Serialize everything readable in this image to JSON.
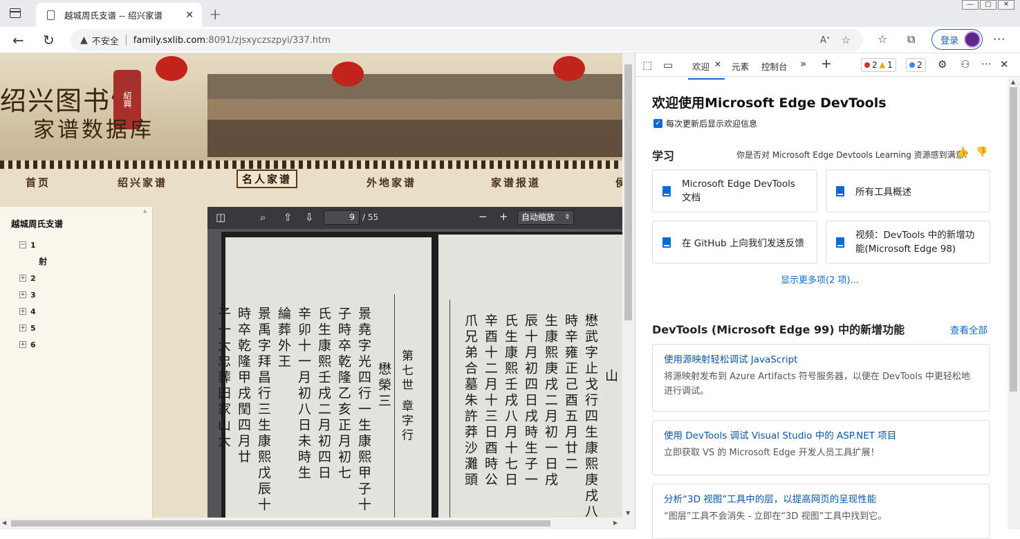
{
  "browser": {
    "tab_title": "越城周氏支谱 -- 绍兴家谱",
    "tab_close": "✕",
    "new_tab": "+",
    "security_label": "不安全",
    "url_host": "family.sxlib.com",
    "url_path": ":8091/zjsxyczszpyi/337.htm",
    "read_aloud": "A̩)",
    "login_label": "登录"
  },
  "site": {
    "banner_title_1": "绍兴图书馆",
    "banner_title_2": "家谱数据库",
    "seal_text": "紹興",
    "menu": [
      "首页",
      "绍兴家谱",
      "名人家谱",
      "外地家谱",
      "家谱报道",
      "侯"
    ],
    "menu_active": 2
  },
  "tree": {
    "root": "越城周氏支谱",
    "nodes": [
      {
        "label": "1",
        "expanded": true,
        "children": [
          "射"
        ]
      },
      {
        "label": "2",
        "expanded": false,
        "children": []
      },
      {
        "label": "3",
        "expanded": false,
        "children": []
      },
      {
        "label": "4",
        "expanded": false,
        "children": []
      },
      {
        "label": "5",
        "expanded": false,
        "children": []
      },
      {
        "label": "6",
        "expanded": false,
        "children": []
      }
    ]
  },
  "viewer": {
    "current_page": "9",
    "total_pages": "/ 55",
    "zoom_label": "自动缩放",
    "scan_columns_right": [
      "山",
      "懋武字止戈行四生康熙庚戌八",
      "時辛雍正己酉五月廿二",
      "生康熙庚戌二月初一日戌",
      "辰十月初四日戌時生子一",
      "氏生康熙壬戌八月十七日",
      "辛酉十二月十三日酉時公",
      "爪兄弟合墓朱許莽沙灘頭"
    ],
    "scan_columns_left": [
      "懋榮三",
      "景堯字光四行一生康熙甲子十",
      "子時卒乾隆乙亥正月初七",
      "氏生康熙壬戌二月初四日",
      "辛卯十一月初八日未時生",
      "綸葬外王",
      "景禹字拜昌行三生康熙戊辰十",
      "時卒乾隆甲戌閏四月廿",
      "子一大忠葬田家山大",
      "第七世 章字行"
    ]
  },
  "devtools": {
    "tabs": [
      "欢迎",
      "元素",
      "控制台"
    ],
    "errors": "2",
    "warnings": "1",
    "info": "2",
    "title": "欢迎使用Microsoft Edge DevTools",
    "checkbox_label": "每次更新后显示欢迎信息",
    "learn_heading": "学习",
    "learn_question": "你是否对 Microsoft Edge Devtools Learning 资源感到满意?",
    "cards": [
      "Microsoft Edge DevTools 文档",
      "所有工具概述",
      "在 GitHub 上向我们发送反馈",
      "视频：DevTools 中的新增功能(Microsoft Edge 98)"
    ],
    "show_more": "显示更多项(2 项)...",
    "new_heading": "DevTools (Microsoft Edge 99) 中的新增功能",
    "view_all": "查看全部",
    "news": [
      {
        "title": "使用源映射轻松调试 JavaScript",
        "desc": "将源映射发布到 Azure Artifacts 符号服务器，以便在 DevTools 中更轻松地进行调试。"
      },
      {
        "title": "使用 DevTools 调试 Visual Studio 中的 ASP.NET 项目",
        "desc": "立即获取 VS 的 Microsoft Edge 开发人员工具扩展！"
      },
      {
        "title": "分析“3D 视图”工具中的层，以提高网页的呈现性能",
        "desc": "“图层”工具不会消失 - 立即在“3D 视图”工具中找到它。"
      }
    ]
  },
  "colors": {
    "accent": "#0a6cce",
    "error": "#d13438",
    "warning": "#f7a400",
    "info": "#3a86ff"
  }
}
